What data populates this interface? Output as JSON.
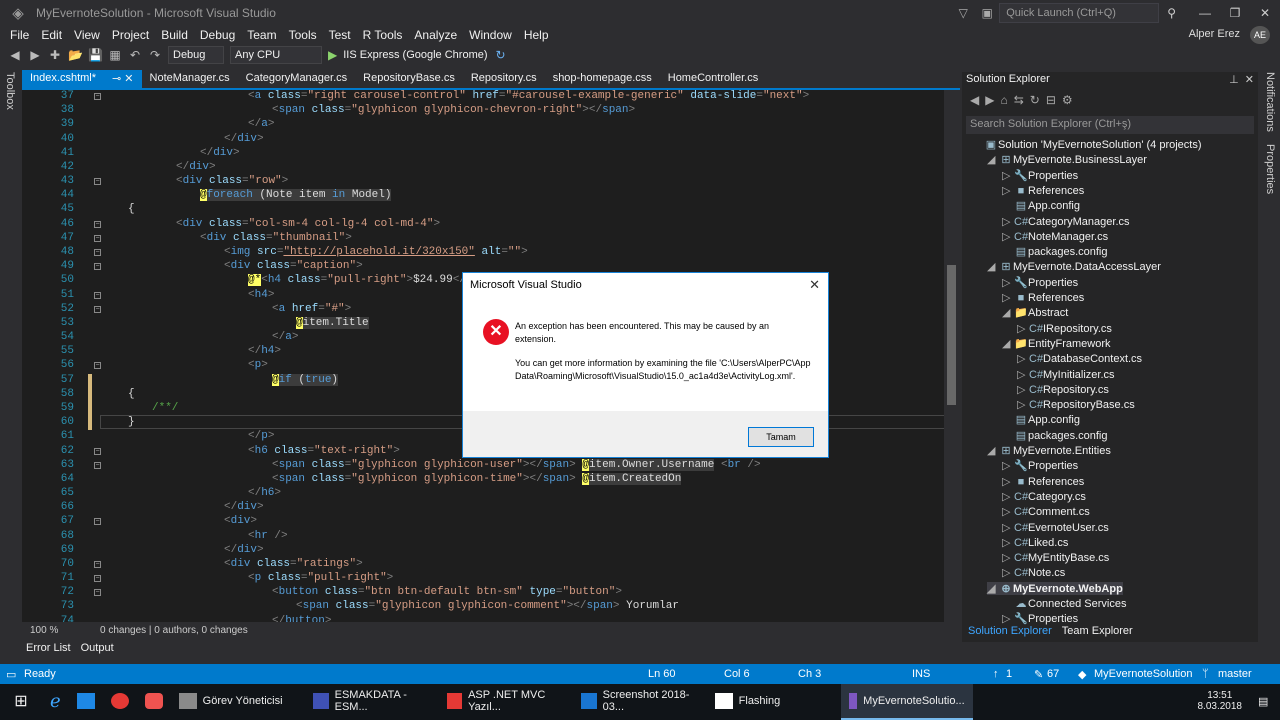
{
  "window": {
    "title": "MyEvernoteSolution - Microsoft Visual Studio",
    "quick_launch": "Quick Launch (Ctrl+Q)",
    "user": "Alper Erez",
    "initials": "AE"
  },
  "menu": [
    "File",
    "Edit",
    "View",
    "Project",
    "Build",
    "Debug",
    "Team",
    "Tools",
    "Test",
    "R Tools",
    "Analyze",
    "Window",
    "Help"
  ],
  "toolbar": {
    "config": "Debug",
    "platform": "Any CPU",
    "run_target": "IIS Express (Google Chrome)"
  },
  "side": {
    "toolbox": "Toolbox",
    "notifications": "Notifications",
    "properties": "Properties"
  },
  "tabs": [
    "Index.cshtml*",
    "NoteManager.cs",
    "CategoryManager.cs",
    "RepositoryBase.cs",
    "Repository.cs",
    "shop-homepage.css",
    "HomeController.cs"
  ],
  "code_lines": [
    {
      "n": "37",
      "html": "<span class='t'>&lt;</span><span class='tn'>a</span> <span class='at'>class</span><span class='t'>=</span><span class='av'>\"right carousel-control\"</span> <span class='at'>href</span><span class='t'>=</span><span class='av'>\"#carousel-example-generic\"</span> <span class='at'>data-slide</span><span class='t'>=</span><span class='av'>\"next\"</span><span class='t'>&gt;</span>",
      "indent": 20
    },
    {
      "n": "38",
      "html": "<span class='t'>&lt;</span><span class='tn'>span</span> <span class='at'>class</span><span class='t'>=</span><span class='av'>\"glyphicon glyphicon-chevron-right\"</span><span class='t'>&gt;&lt;/</span><span class='tn'>span</span><span class='t'>&gt;</span>",
      "indent": 24
    },
    {
      "n": "39",
      "html": "<span class='t'>&lt;/</span><span class='tn'>a</span><span class='t'>&gt;</span>",
      "indent": 20
    },
    {
      "n": "40",
      "html": "<span class='t'>&lt;/</span><span class='tn'>div</span><span class='t'>&gt;</span>",
      "indent": 16
    },
    {
      "n": "41",
      "html": "<span class='t'>&lt;/</span><span class='tn'>div</span><span class='t'>&gt;</span>",
      "indent": 12
    },
    {
      "n": "42",
      "html": "<span class='t'>&lt;/</span><span class='tn'>div</span><span class='t'>&gt;</span>",
      "indent": 8
    },
    {
      "n": "43",
      "html": "<span class='t'>&lt;</span><span class='tn'>div</span> <span class='at'>class</span><span class='t'>=</span><span class='av'>\"row\"</span><span class='t'>&gt;</span>",
      "indent": 8
    },
    {
      "n": "44",
      "html": "<span class='ats'>@</span><span class='rz'><span class='kw'>foreach</span> (Note item <span class='kw'>in</span> Model)</span>",
      "indent": 12
    },
    {
      "n": "45",
      "html": "{",
      "indent": 0
    },
    {
      "n": "46",
      "html": "<span class='t'>&lt;</span><span class='tn'>div</span> <span class='at'>class</span><span class='t'>=</span><span class='av'>\"col-sm-4 col-lg-4 col-md-4\"</span><span class='t'>&gt;</span>",
      "indent": 8
    },
    {
      "n": "47",
      "html": "<span class='t'>&lt;</span><span class='tn'>div</span> <span class='at'>class</span><span class='t'>=</span><span class='av'>\"thumbnail\"</span><span class='t'>&gt;</span>",
      "indent": 12
    },
    {
      "n": "48",
      "html": "<span class='t'>&lt;</span><span class='tn'>img</span> <span class='at'>src</span><span class='t'>=</span><span class='av' style='text-decoration:underline'>\"http://placehold.it/320x150\"</span> <span class='at'>alt</span><span class='t'>=</span><span class='av'>\"\"</span><span class='t'>&gt;</span>",
      "indent": 16
    },
    {
      "n": "49",
      "html": "<span class='t'>&lt;</span><span class='tn'>div</span> <span class='at'>class</span><span class='t'>=</span><span class='av'>\"caption\"</span><span class='t'>&gt;</span>",
      "indent": 16
    },
    {
      "n": "50",
      "html": "<span class='ats'>@*</span><span class='t'>&lt;</span><span class='tn'>h4</span> <span class='at'>class</span><span class='t'>=</span><span class='av'>\"pull-right\"</span><span class='t'>&gt;</span>$24.99<span class='t'>&lt;/</span><span class='tn'>h4</span><span class='t'>&gt;</span>",
      "indent": 20
    },
    {
      "n": "51",
      "html": "<span class='t'>&lt;</span><span class='tn'>h4</span><span class='t'>&gt;</span>",
      "indent": 20
    },
    {
      "n": "52",
      "html": "<span class='t'>&lt;</span><span class='tn'>a</span> <span class='at'>href</span><span class='t'>=</span><span class='av'>\"#\"</span><span class='t'>&gt;</span>",
      "indent": 24
    },
    {
      "n": "53",
      "html": "<span class='ats'>@</span><span class='rz'>item.Title</span>",
      "indent": 28
    },
    {
      "n": "54",
      "html": "<span class='t'>&lt;/</span><span class='tn'>a</span><span class='t'>&gt;</span>",
      "indent": 24
    },
    {
      "n": "55",
      "html": "<span class='t'>&lt;/</span><span class='tn'>h4</span><span class='t'>&gt;</span>",
      "indent": 20
    },
    {
      "n": "56",
      "html": "<span class='t'>&lt;</span><span class='tn'>p</span><span class='t'>&gt;</span>",
      "indent": 20
    },
    {
      "n": "57",
      "html": "<span class='ats'>@</span><span class='rz'><span class='kw'>if</span> (<span class='kw'>true</span>)</span>",
      "indent": 24
    },
    {
      "n": "58",
      "html": "{",
      "indent": 0
    },
    {
      "n": "59",
      "html": "<span style='color:#57a64a'>/**/</span>",
      "indent": 4
    },
    {
      "n": "60",
      "html": "}",
      "indent": 0
    },
    {
      "n": "61",
      "html": "<span class='t'>&lt;/</span><span class='tn'>p</span><span class='t'>&gt;</span>",
      "indent": 20
    },
    {
      "n": "62",
      "html": "<span class='t'>&lt;</span><span class='tn'>h6</span> <span class='at'>class</span><span class='t'>=</span><span class='av'>\"text-right\"</span><span class='t'>&gt;</span>",
      "indent": 20
    },
    {
      "n": "63",
      "html": "<span class='t'>&lt;</span><span class='tn'>span</span> <span class='at'>class</span><span class='t'>=</span><span class='av'>\"glyphicon glyphicon-user\"</span><span class='t'>&gt;&lt;/</span><span class='tn'>span</span><span class='t'>&gt;</span> <span class='ats'>@</span><span class='rz'>item.Owner.Username</span> <span class='t'>&lt;</span><span class='tn'>br</span> <span class='t'>/&gt;</span>",
      "indent": 24
    },
    {
      "n": "64",
      "html": "<span class='t'>&lt;</span><span class='tn'>span</span> <span class='at'>class</span><span class='t'>=</span><span class='av'>\"glyphicon glyphicon-time\"</span><span class='t'>&gt;&lt;/</span><span class='tn'>span</span><span class='t'>&gt;</span> <span class='ats'>@</span><span class='rz'>item.CreatedOn</span>",
      "indent": 24
    },
    {
      "n": "65",
      "html": "<span class='t'>&lt;/</span><span class='tn'>h6</span><span class='t'>&gt;</span>",
      "indent": 20
    },
    {
      "n": "66",
      "html": "<span class='t'>&lt;/</span><span class='tn'>div</span><span class='t'>&gt;</span>",
      "indent": 16
    },
    {
      "n": "67",
      "html": "<span class='t'>&lt;</span><span class='tn'>div</span><span class='t'>&gt;</span>",
      "indent": 16
    },
    {
      "n": "68",
      "html": "<span class='t'>&lt;</span><span class='tn'>hr</span> <span class='t'>/&gt;</span>",
      "indent": 20
    },
    {
      "n": "69",
      "html": "<span class='t'>&lt;/</span><span class='tn'>div</span><span class='t'>&gt;</span>",
      "indent": 16
    },
    {
      "n": "70",
      "html": "<span class='t'>&lt;</span><span class='tn'>div</span> <span class='at'>class</span><span class='t'>=</span><span class='av'>\"ratings\"</span><span class='t'>&gt;</span>",
      "indent": 16
    },
    {
      "n": "71",
      "html": "<span class='t'>&lt;</span><span class='tn'>p</span> <span class='at'>class</span><span class='t'>=</span><span class='av'>\"pull-right\"</span><span class='t'>&gt;</span>",
      "indent": 20
    },
    {
      "n": "72",
      "html": "<span class='t'>&lt;</span><span class='tn'>button</span> <span class='at'>class</span><span class='t'>=</span><span class='av'>\"btn btn-default btn-sm\"</span> <span class='at'>type</span><span class='t'>=</span><span class='av'>\"button\"</span><span class='t'>&gt;</span>",
      "indent": 24
    },
    {
      "n": "73",
      "html": "<span class='t'>&lt;</span><span class='tn'>span</span> <span class='at'>class</span><span class='t'>=</span><span class='av'>\"glyphicon glyphicon-comment\"</span><span class='t'>&gt;&lt;/</span><span class='tn'>span</span><span class='t'>&gt;</span> Yorumlar",
      "indent": 28
    },
    {
      "n": "74",
      "html": "<span class='t'>&lt;/</span><span class='tn'>button</span><span class='t'>&gt;</span>",
      "indent": 24
    }
  ],
  "editor_status": {
    "zoom": "100 %",
    "changes": "0 changes | 0 authors, 0 changes"
  },
  "bottom_tabs": [
    "Error List",
    "Output"
  ],
  "solution_explorer": {
    "title": "Solution Explorer",
    "search": "Search Solution Explorer (Ctrl+ş)",
    "items": [
      {
        "label": "Solution 'MyEvernoteSolution' (4 projects)",
        "level": 0,
        "arrow": "",
        "icon": "▣"
      },
      {
        "label": "MyEvernote.BusinessLayer",
        "level": 1,
        "arrow": "◢",
        "icon": "⊞"
      },
      {
        "label": "Properties",
        "level": 2,
        "arrow": "▷",
        "icon": "🔧"
      },
      {
        "label": "References",
        "level": 2,
        "arrow": "▷",
        "icon": "■"
      },
      {
        "label": "App.config",
        "level": 2,
        "arrow": "",
        "icon": "▤"
      },
      {
        "label": "CategoryManager.cs",
        "level": 2,
        "arrow": "▷",
        "icon": "C#"
      },
      {
        "label": "NoteManager.cs",
        "level": 2,
        "arrow": "▷",
        "icon": "C#"
      },
      {
        "label": "packages.config",
        "level": 2,
        "arrow": "",
        "icon": "▤"
      },
      {
        "label": "MyEvernote.DataAccessLayer",
        "level": 1,
        "arrow": "◢",
        "icon": "⊞"
      },
      {
        "label": "Properties",
        "level": 2,
        "arrow": "▷",
        "icon": "🔧"
      },
      {
        "label": "References",
        "level": 2,
        "arrow": "▷",
        "icon": "■"
      },
      {
        "label": "Abstract",
        "level": 2,
        "arrow": "◢",
        "icon": "📁"
      },
      {
        "label": "IRepository.cs",
        "level": 3,
        "arrow": "▷",
        "icon": "C#"
      },
      {
        "label": "EntityFramework",
        "level": 2,
        "arrow": "◢",
        "icon": "📁"
      },
      {
        "label": "DatabaseContext.cs",
        "level": 3,
        "arrow": "▷",
        "icon": "C#"
      },
      {
        "label": "MyInitializer.cs",
        "level": 3,
        "arrow": "▷",
        "icon": "C#"
      },
      {
        "label": "Repository.cs",
        "level": 3,
        "arrow": "▷",
        "icon": "C#"
      },
      {
        "label": "RepositoryBase.cs",
        "level": 3,
        "arrow": "▷",
        "icon": "C#"
      },
      {
        "label": "App.config",
        "level": 2,
        "arrow": "",
        "icon": "▤"
      },
      {
        "label": "packages.config",
        "level": 2,
        "arrow": "",
        "icon": "▤"
      },
      {
        "label": "MyEvernote.Entities",
        "level": 1,
        "arrow": "◢",
        "icon": "⊞"
      },
      {
        "label": "Properties",
        "level": 2,
        "arrow": "▷",
        "icon": "🔧"
      },
      {
        "label": "References",
        "level": 2,
        "arrow": "▷",
        "icon": "■"
      },
      {
        "label": "Category.cs",
        "level": 2,
        "arrow": "▷",
        "icon": "C#"
      },
      {
        "label": "Comment.cs",
        "level": 2,
        "arrow": "▷",
        "icon": "C#"
      },
      {
        "label": "EvernoteUser.cs",
        "level": 2,
        "arrow": "▷",
        "icon": "C#"
      },
      {
        "label": "Liked.cs",
        "level": 2,
        "arrow": "▷",
        "icon": "C#"
      },
      {
        "label": "MyEntityBase.cs",
        "level": 2,
        "arrow": "▷",
        "icon": "C#"
      },
      {
        "label": "Note.cs",
        "level": 2,
        "arrow": "▷",
        "icon": "C#"
      },
      {
        "label": "MyEvernote.WebApp",
        "level": 1,
        "arrow": "◢",
        "icon": "⊕",
        "selected": true
      },
      {
        "label": "Connected Services",
        "level": 2,
        "arrow": "",
        "icon": "☁"
      },
      {
        "label": "Properties",
        "level": 2,
        "arrow": "▷",
        "icon": "🔧"
      }
    ],
    "bottom_tabs": [
      "Solution Explorer",
      "Team Explorer"
    ]
  },
  "status": {
    "ready": "Ready",
    "ln": "Ln 60",
    "col": "Col 6",
    "ch": "Ch 3",
    "ins": "INS",
    "up": "1",
    "edits": "67",
    "solution": "MyEvernoteSolution",
    "branch": "master"
  },
  "taskbar": {
    "items": [
      "Görev Yöneticisi",
      "ESMAKDATA - ESM...",
      "ASP .NET MVC Yazıl...",
      "Screenshot 2018-03...",
      "Flashing",
      "MyEvernoteSolutio..."
    ],
    "time": "13:51",
    "date": "8.03.2018"
  },
  "dialog": {
    "title": "Microsoft Visual Studio",
    "line1": "An exception has been encountered. This may be caused by an extension.",
    "line2": "You can get more information by examining the file 'C:\\Users\\AlperPC\\AppData\\Roaming\\Microsoft\\VisualStudio\\15.0_ac1a4d3e\\ActivityLog.xml'.",
    "ok": "Tamam"
  }
}
